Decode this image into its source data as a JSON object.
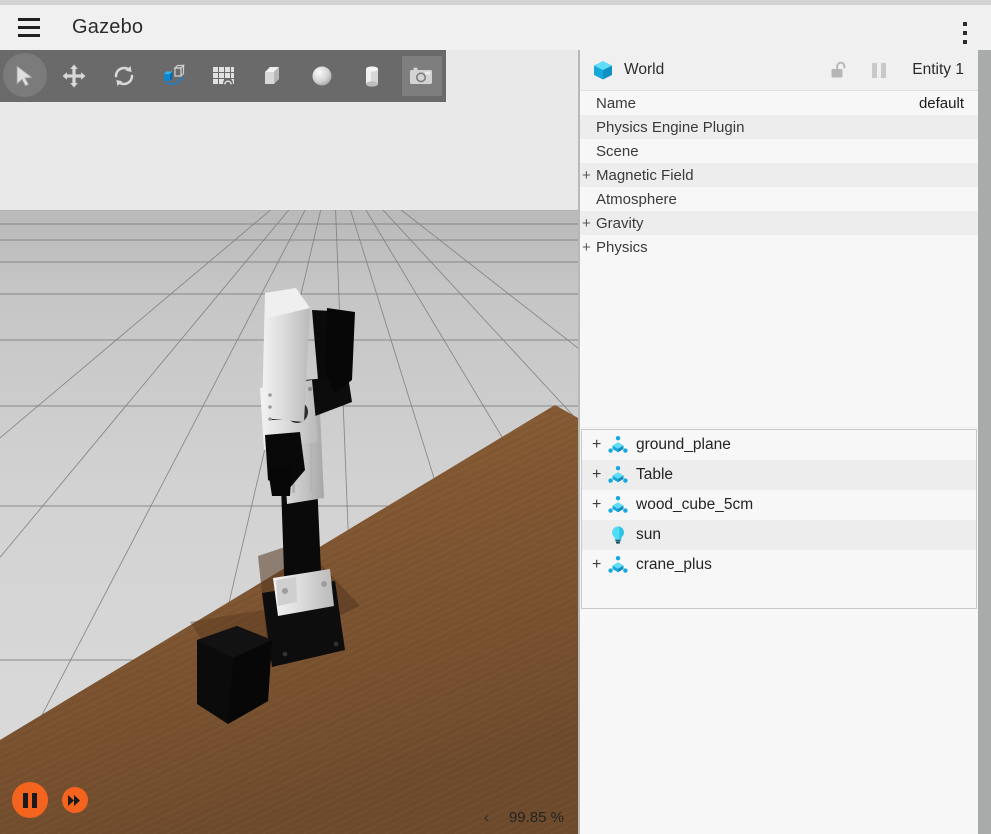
{
  "app": {
    "title": "Gazebo",
    "menu_icon": "hamburger-icon",
    "overflow_icon": "kebab-menu-icon"
  },
  "toolbar": {
    "items": [
      {
        "name": "select-tool",
        "icon": "cursor-arrow-icon",
        "label": "Select",
        "selected": true
      },
      {
        "name": "translate-tool",
        "icon": "move-arrows-icon",
        "label": "Translate",
        "selected": false
      },
      {
        "name": "rotate-tool",
        "icon": "rotate-arrows-icon",
        "label": "Rotate",
        "selected": false
      },
      {
        "name": "transform-tool",
        "icon": "transform-cube-icon",
        "label": "Transform",
        "selected": false
      },
      {
        "name": "grid-tool",
        "icon": "grid-icon",
        "label": "Grid",
        "selected": false
      },
      {
        "name": "box-tool",
        "icon": "box-icon",
        "label": "Box",
        "selected": false
      },
      {
        "name": "sphere-tool",
        "icon": "sphere-icon",
        "label": "Sphere",
        "selected": false
      },
      {
        "name": "cylinder-tool",
        "icon": "cylinder-icon",
        "label": "Cylinder",
        "selected": false
      },
      {
        "name": "screenshot-tool",
        "icon": "camera-icon",
        "label": "Screenshot",
        "selected": true
      }
    ]
  },
  "viewport": {
    "playback": {
      "pause_label": "Pause",
      "pause_icon": "pause-icon",
      "step_label": "Step",
      "step_icon": "step-forward-icon"
    },
    "status": {
      "collapse_icon": "chevron-left-icon",
      "real_time_factor": "99.85 %"
    },
    "scene": {
      "sky_color": "#e9e9e9",
      "ground_color": "#cccccc",
      "table_color": "#8a5f38",
      "accent_color": "#f4641e"
    }
  },
  "world_panel": {
    "header": {
      "icon": "world-cube-icon",
      "title": "World",
      "lock_icon": "unlocked-padlock-icon",
      "pause_icon": "pause-icon",
      "entity_label": "Entity 1"
    },
    "properties": [
      {
        "name": "Name",
        "value": "default",
        "expandable": false
      },
      {
        "name": "Physics Engine Plugin",
        "value": "",
        "expandable": false
      },
      {
        "name": "Scene",
        "value": "",
        "expandable": false
      },
      {
        "name": "Magnetic Field",
        "value": "",
        "expandable": true
      },
      {
        "name": "Atmosphere",
        "value": "",
        "expandable": false
      },
      {
        "name": "Gravity",
        "value": "",
        "expandable": true
      },
      {
        "name": "Physics",
        "value": "",
        "expandable": true
      }
    ]
  },
  "entity_tree": {
    "items": [
      {
        "label": "ground_plane",
        "icon": "model-icon",
        "expandable": true
      },
      {
        "label": "Table",
        "icon": "model-icon",
        "expandable": true
      },
      {
        "label": "wood_cube_5cm",
        "icon": "model-icon",
        "expandable": true
      },
      {
        "label": "sun",
        "icon": "light-bulb-icon",
        "expandable": false
      },
      {
        "label": "crane_plus",
        "icon": "model-icon",
        "expandable": true
      }
    ]
  }
}
